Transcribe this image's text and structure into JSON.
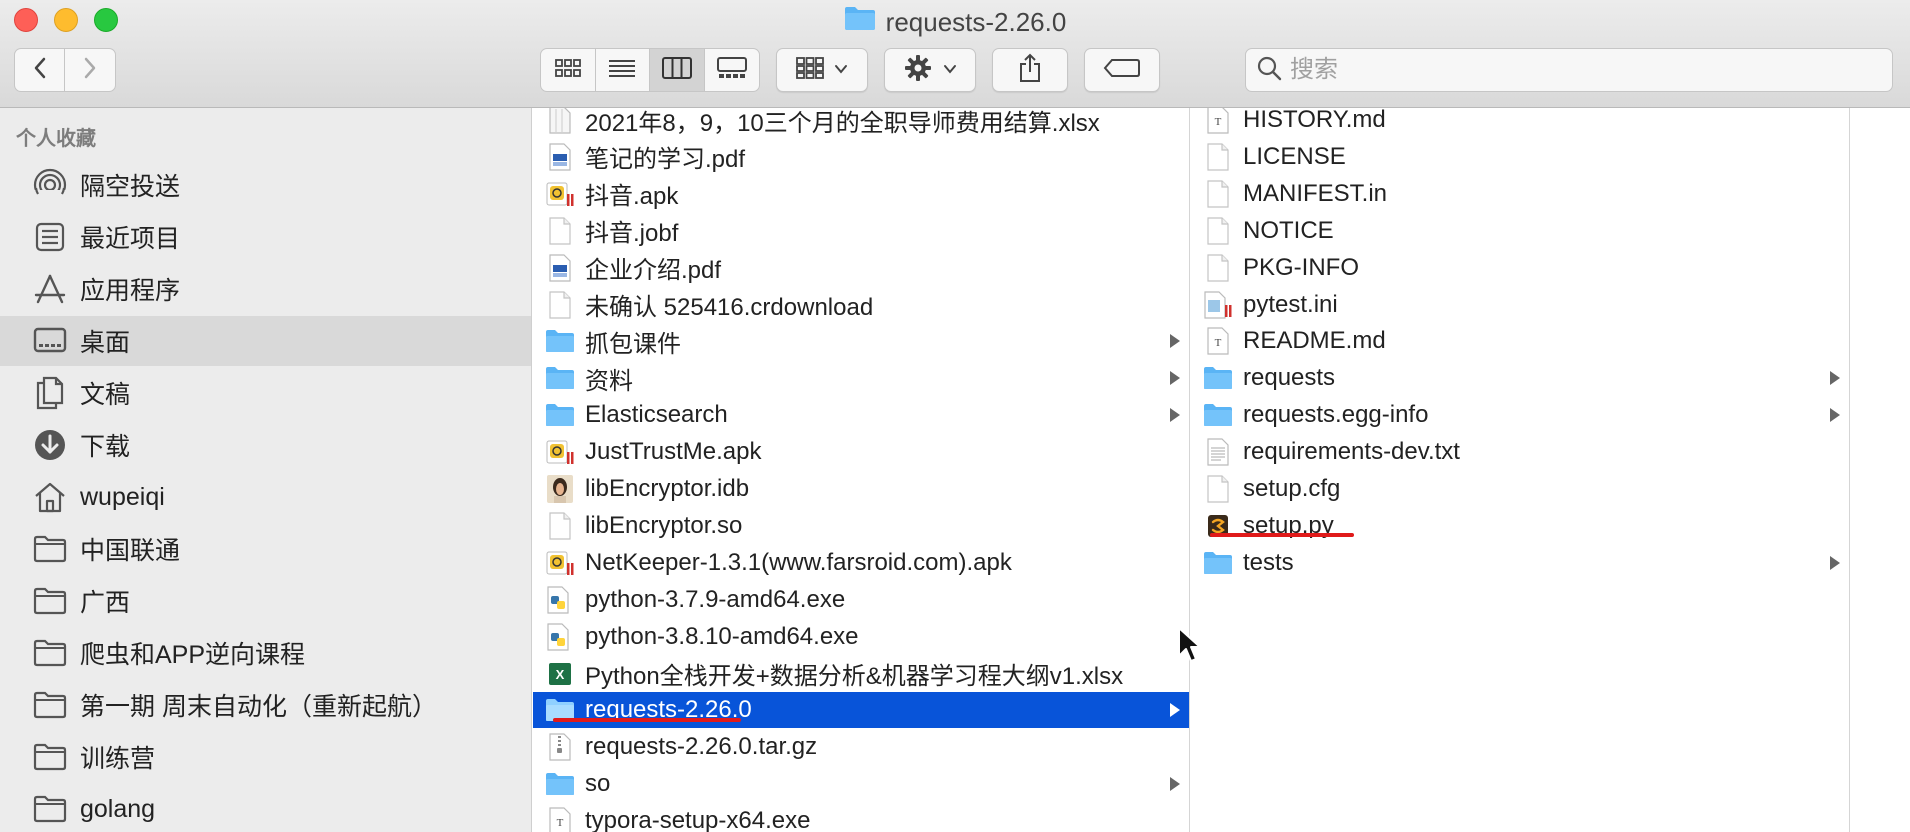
{
  "window": {
    "title": "requests-2.26.0",
    "colors": {
      "selection": "#0854d9",
      "folder": "#5ab4f5",
      "annotation": "#e01a1a"
    }
  },
  "toolbar": {
    "back_icon": "chevron-left-icon",
    "forward_icon": "chevron-right-icon",
    "view_modes": [
      "icon-view",
      "list-view",
      "column-view",
      "gallery-view"
    ],
    "active_view": "column-view",
    "search_placeholder": "搜索"
  },
  "sidebar": {
    "header": "个人收藏",
    "items": [
      {
        "label": "隔空投送",
        "icon": "airdrop-icon"
      },
      {
        "label": "最近项目",
        "icon": "recents-icon"
      },
      {
        "label": "应用程序",
        "icon": "applications-icon"
      },
      {
        "label": "桌面",
        "icon": "desktop-icon",
        "selected": true
      },
      {
        "label": "文稿",
        "icon": "documents-icon"
      },
      {
        "label": "下载",
        "icon": "downloads-icon"
      },
      {
        "label": "wupeiqi",
        "icon": "home-icon"
      },
      {
        "label": "中国联通",
        "icon": "folder-icon"
      },
      {
        "label": "广西",
        "icon": "folder-icon"
      },
      {
        "label": "爬虫和APP逆向课程",
        "icon": "folder-icon"
      },
      {
        "label": "第一期 周末自动化（重新起航）",
        "icon": "folder-icon"
      },
      {
        "label": "训练营",
        "icon": "folder-icon"
      },
      {
        "label": "golang",
        "icon": "folder-icon"
      }
    ]
  },
  "column1": {
    "items": [
      {
        "name": "2021年8，9，10三个月的全职导师费用结算.xlsx",
        "kind": "spreadsheet"
      },
      {
        "name": "笔记的学习.pdf",
        "kind": "pdf"
      },
      {
        "name": "抖音.apk",
        "kind": "apk"
      },
      {
        "name": "抖音.jobf",
        "kind": "file"
      },
      {
        "name": "企业介绍.pdf",
        "kind": "pdf"
      },
      {
        "name": "未确认 525416.crdownload",
        "kind": "file"
      },
      {
        "name": "抓包课件",
        "kind": "folder",
        "arrow": true
      },
      {
        "name": "资料",
        "kind": "folder",
        "arrow": true
      },
      {
        "name": "Elasticsearch",
        "kind": "folder",
        "arrow": true
      },
      {
        "name": "JustTrustMe.apk",
        "kind": "apk"
      },
      {
        "name": "libEncryptor.idb",
        "kind": "image"
      },
      {
        "name": "libEncryptor.so",
        "kind": "file"
      },
      {
        "name": "NetKeeper-1.3.1(www.farsroid.com).apk",
        "kind": "apk"
      },
      {
        "name": "python-3.7.9-amd64.exe",
        "kind": "exe"
      },
      {
        "name": "python-3.8.10-amd64.exe",
        "kind": "exe"
      },
      {
        "name": "Python全栈开发+数据分析&机器学习程大纲v1.xlsx",
        "kind": "excel"
      },
      {
        "name": "requests-2.26.0",
        "kind": "folder",
        "arrow": true,
        "selected": true
      },
      {
        "name": "requests-2.26.0.tar.gz",
        "kind": "archive"
      },
      {
        "name": "so",
        "kind": "folder",
        "arrow": true
      },
      {
        "name": "typora-setup-x64.exe",
        "kind": "text"
      }
    ]
  },
  "column2": {
    "items": [
      {
        "name": "HISTORY.md",
        "kind": "text"
      },
      {
        "name": "LICENSE",
        "kind": "file"
      },
      {
        "name": "MANIFEST.in",
        "kind": "file"
      },
      {
        "name": "NOTICE",
        "kind": "file"
      },
      {
        "name": "PKG-INFO",
        "kind": "file"
      },
      {
        "name": "pytest.ini",
        "kind": "ini"
      },
      {
        "name": "README.md",
        "kind": "text"
      },
      {
        "name": "requests",
        "kind": "folder",
        "arrow": true
      },
      {
        "name": "requests.egg-info",
        "kind": "folder",
        "arrow": true
      },
      {
        "name": "requirements-dev.txt",
        "kind": "txt"
      },
      {
        "name": "setup.cfg",
        "kind": "file"
      },
      {
        "name": "setup.py",
        "kind": "python"
      },
      {
        "name": "tests",
        "kind": "folder",
        "arrow": true
      }
    ]
  }
}
